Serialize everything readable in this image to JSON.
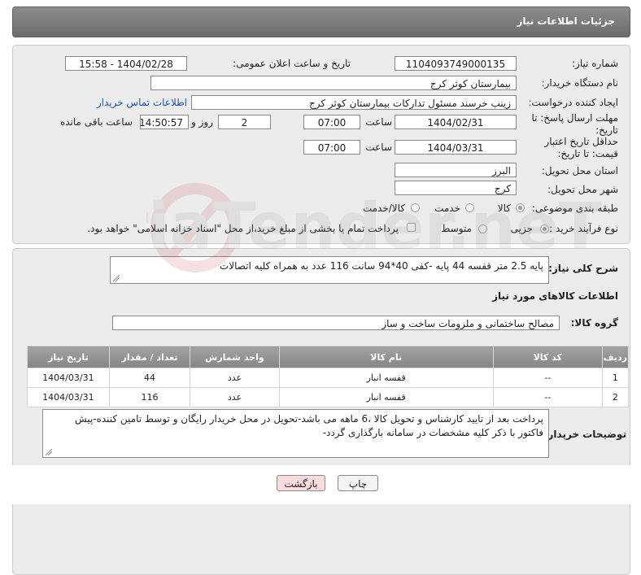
{
  "header": {
    "title": "جزئیات اطلاعات نیاز"
  },
  "form": {
    "need_number_label": "شماره نیاز:",
    "need_number": "1104093749000135",
    "announce_label": "تاریخ و ساعت اعلان عمومی:",
    "announce_value": "1404/02/28 - 15:58",
    "buyer_org_label": "نام دستگاه خریدار:",
    "buyer_org": "بیمارستان کوثر کرج",
    "requester_label": "ایجاد کننده درخواست:",
    "requester": "زینب خرسند مسئول تدارکات بیمارستان کوثر کرج",
    "buyer_contact_link": "اطلاعات تماس خریدار",
    "reply_deadline_label": "مهلت ارسال پاسخ: تا تاریخ:",
    "reply_date": "1404/02/31",
    "time_label": "ساعت",
    "reply_time": "07:00",
    "days_value": "2",
    "days_label": "روز و",
    "remaining_time": "14:50:57",
    "remaining_label": "ساعت باقی مانده",
    "price_validity_label": "حداقل تاریخ اعتبار قیمت: تا تاریخ:",
    "price_date": "1404/03/31",
    "price_time": "07:00",
    "province_label": "استان محل تحویل:",
    "province": "البرز",
    "city_label": "شهر محل تحویل:",
    "city": "کرج",
    "category_label": "طبقه بندی موضوعی:",
    "category_options": [
      "کالا",
      "خدمت",
      "کالا/خدمت"
    ],
    "category_selected": "کالا",
    "purchase_type_label": "نوع فرآیند خرید :",
    "purchase_options": [
      "جزیی",
      "متوسط"
    ],
    "purchase_selected": "جزیی",
    "treasury_note": "پرداخت تمام یا بخشی از مبلغ خرید،از محل \"اسناد خزانه اسلامی\" خواهد بود."
  },
  "description": {
    "label": "شرح کلی نیاز:",
    "text": "پایه 2.5 متر قفسه 44 پایه -کفی 40*94 سانت  116 عدد  به همراه کلیه اتصالات"
  },
  "goods_info": {
    "title": "اطلاعات کالاهای مورد نیاز",
    "group_label": "گروه کالا:",
    "group_value": "مصالح ساختمانی و ملزومات ساخت و ساز"
  },
  "table": {
    "headers": [
      "ردیف",
      "کد کالا",
      "نام کالا",
      "واحد شمارش",
      "تعداد / مقدار",
      "تاریخ نیاز"
    ],
    "rows": [
      {
        "row": "1",
        "code": "--",
        "name": "قفسه انبار",
        "unit": "عدد",
        "qty": "44",
        "date": "1404/03/31"
      },
      {
        "row": "2",
        "code": "--",
        "name": "قفسه انبار",
        "unit": "عدد",
        "qty": "116",
        "date": "1404/03/31"
      }
    ]
  },
  "buyer_notes": {
    "label": "توضیحات خریدار:",
    "text": "پرداخت بعد از تایید کارشناس و تحویل کالا ،6 ماهه می باشد-تحویل در محل خریدار رایگان و توسط تامین کننده-پیش فاکتور با ذکر کلیه مشخصات در سامانه بارگذاری گردد-"
  },
  "buttons": {
    "print": "چاپ",
    "back": "بازگشت"
  },
  "watermark": {
    "text": "AriaTender.neT"
  },
  "colors": {
    "link": "#1a55b8",
    "title_bar": "#7a7a7a",
    "back_button_bg": "#f6dcdc"
  }
}
